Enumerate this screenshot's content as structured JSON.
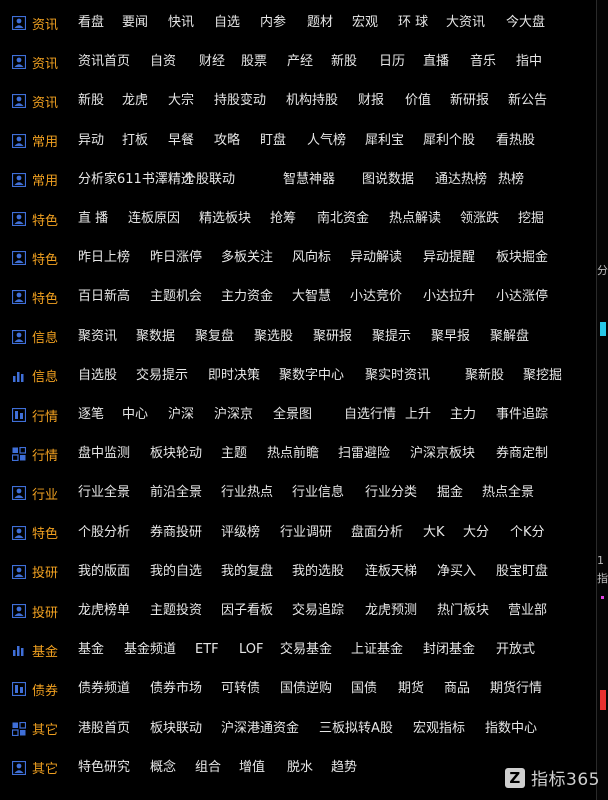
{
  "menu": {
    "rows": [
      {
        "category": "资讯",
        "icon": "user-icon",
        "items": [
          "看盘",
          "要闻",
          "快讯",
          "自选",
          "内参",
          "题材",
          "宏观",
          "环 球",
          "大资讯",
          "今大盘"
        ]
      },
      {
        "category": "资讯",
        "icon": "user-icon",
        "items": [
          "资讯首页",
          "自资",
          "财经",
          "股票",
          "产经",
          "新股",
          "日历",
          "直播",
          "音乐",
          "指中"
        ]
      },
      {
        "category": "资讯",
        "icon": "user-icon",
        "items": [
          "新股",
          "龙虎",
          "大宗",
          "持股变动",
          "机构持股",
          "财报",
          "价值",
          "新研报",
          "新公告"
        ]
      },
      {
        "category": "常用",
        "icon": "user-icon",
        "items": [
          "异动",
          "打板",
          "早餐",
          "攻略",
          "盯盘",
          "人气榜",
          "犀利宝",
          "犀利个股",
          "看热股"
        ]
      },
      {
        "category": "常用",
        "icon": "user-icon",
        "items": [
          "分析家611书澤精选",
          "个股联动",
          "智慧神器",
          "图说数据",
          "通达热榜",
          "热榜"
        ]
      },
      {
        "category": "特色",
        "icon": "user-icon",
        "items": [
          "直 播",
          "连板原因",
          "精选板块",
          "抢筹",
          "南北资金",
          "热点解读",
          "领涨跌",
          "挖掘"
        ]
      },
      {
        "category": "特色",
        "icon": "user-icon",
        "items": [
          "昨日上榜",
          "昨日涨停",
          "多板关注",
          "风向标",
          "异动解读",
          "异动提醒",
          "板块掘金"
        ]
      },
      {
        "category": "特色",
        "icon": "user-icon",
        "items": [
          "百日新高",
          "主题机会",
          "主力资金",
          "大智慧",
          "小达竞价",
          "小达拉升",
          "小达涨停"
        ]
      },
      {
        "category": "信息",
        "icon": "user-icon",
        "items": [
          "聚资讯",
          "聚数据",
          "聚复盘",
          "聚选股",
          "聚研报",
          "聚提示",
          "聚早报",
          "聚解盘"
        ]
      },
      {
        "category": "信息",
        "icon": "bar-chart-icon",
        "items": [
          "自选股",
          "交易提示",
          "即时决策",
          "聚数字中心",
          "聚实时资讯",
          "聚新股",
          "聚挖掘"
        ]
      },
      {
        "category": "行情",
        "icon": "quote-icon",
        "items": [
          "逐笔",
          "中心",
          "沪深",
          "沪深京",
          "全景图",
          "自选行情",
          "上升",
          "主力",
          "事件追踪"
        ]
      },
      {
        "category": "行情",
        "icon": "grid-icon",
        "items": [
          "盘中监测",
          "板块轮动",
          "主题",
          "热点前瞻",
          "扫雷避险",
          "沪深京板块",
          "券商定制"
        ]
      },
      {
        "category": "行业",
        "icon": "user-icon",
        "items": [
          "行业全景",
          "前沿全景",
          "行业热点",
          "行业信息",
          "行业分类",
          "掘金",
          "热点全景"
        ]
      },
      {
        "category": "特色",
        "icon": "user-icon",
        "items": [
          "个股分析",
          "券商投研",
          "评级榜",
          "行业调研",
          "盘面分析",
          "大K",
          "大分",
          "个K分"
        ]
      },
      {
        "category": "投研",
        "icon": "user-icon",
        "items": [
          "我的版面",
          "我的自选",
          "我的复盘",
          "我的选股",
          "连板天梯",
          "净买入",
          "股宝盯盘"
        ]
      },
      {
        "category": "投研",
        "icon": "user-icon",
        "items": [
          "龙虎榜单",
          "主题投资",
          "因子看板",
          "交易追踪",
          "龙虎预测",
          "热门板块",
          "营业部"
        ]
      },
      {
        "category": "基金",
        "icon": "bar-chart-icon",
        "items": [
          "基金",
          "基金频道",
          "ETF",
          "LOF",
          "交易基金",
          "上证基金",
          "封闭基金",
          "开放式"
        ]
      },
      {
        "category": "债券",
        "icon": "quote-icon",
        "items": [
          "债券频道",
          "债券市场",
          "可转债",
          "国债逆购",
          "国债",
          "期货",
          "商品",
          "期货行情"
        ]
      },
      {
        "category": "其它",
        "icon": "grid-icon",
        "items": [
          "港股首页",
          "板块联动",
          "沪深港通资金",
          "三板拟转A股",
          "宏观指标",
          "指数中心"
        ]
      },
      {
        "category": "其它",
        "icon": "user-icon",
        "items": [
          "特色研究",
          "概念",
          "组合",
          "增值",
          "脱水",
          "趋势"
        ]
      }
    ]
  },
  "right_panel": {
    "glyphs": [
      "分",
      "1",
      "指"
    ]
  },
  "brand": {
    "name": "指标365",
    "logo_letter": "Z"
  },
  "colors": {
    "category": "#f0a020",
    "icon": "#3f6fd8",
    "item": "#e6e6e6",
    "background": "#000000"
  }
}
